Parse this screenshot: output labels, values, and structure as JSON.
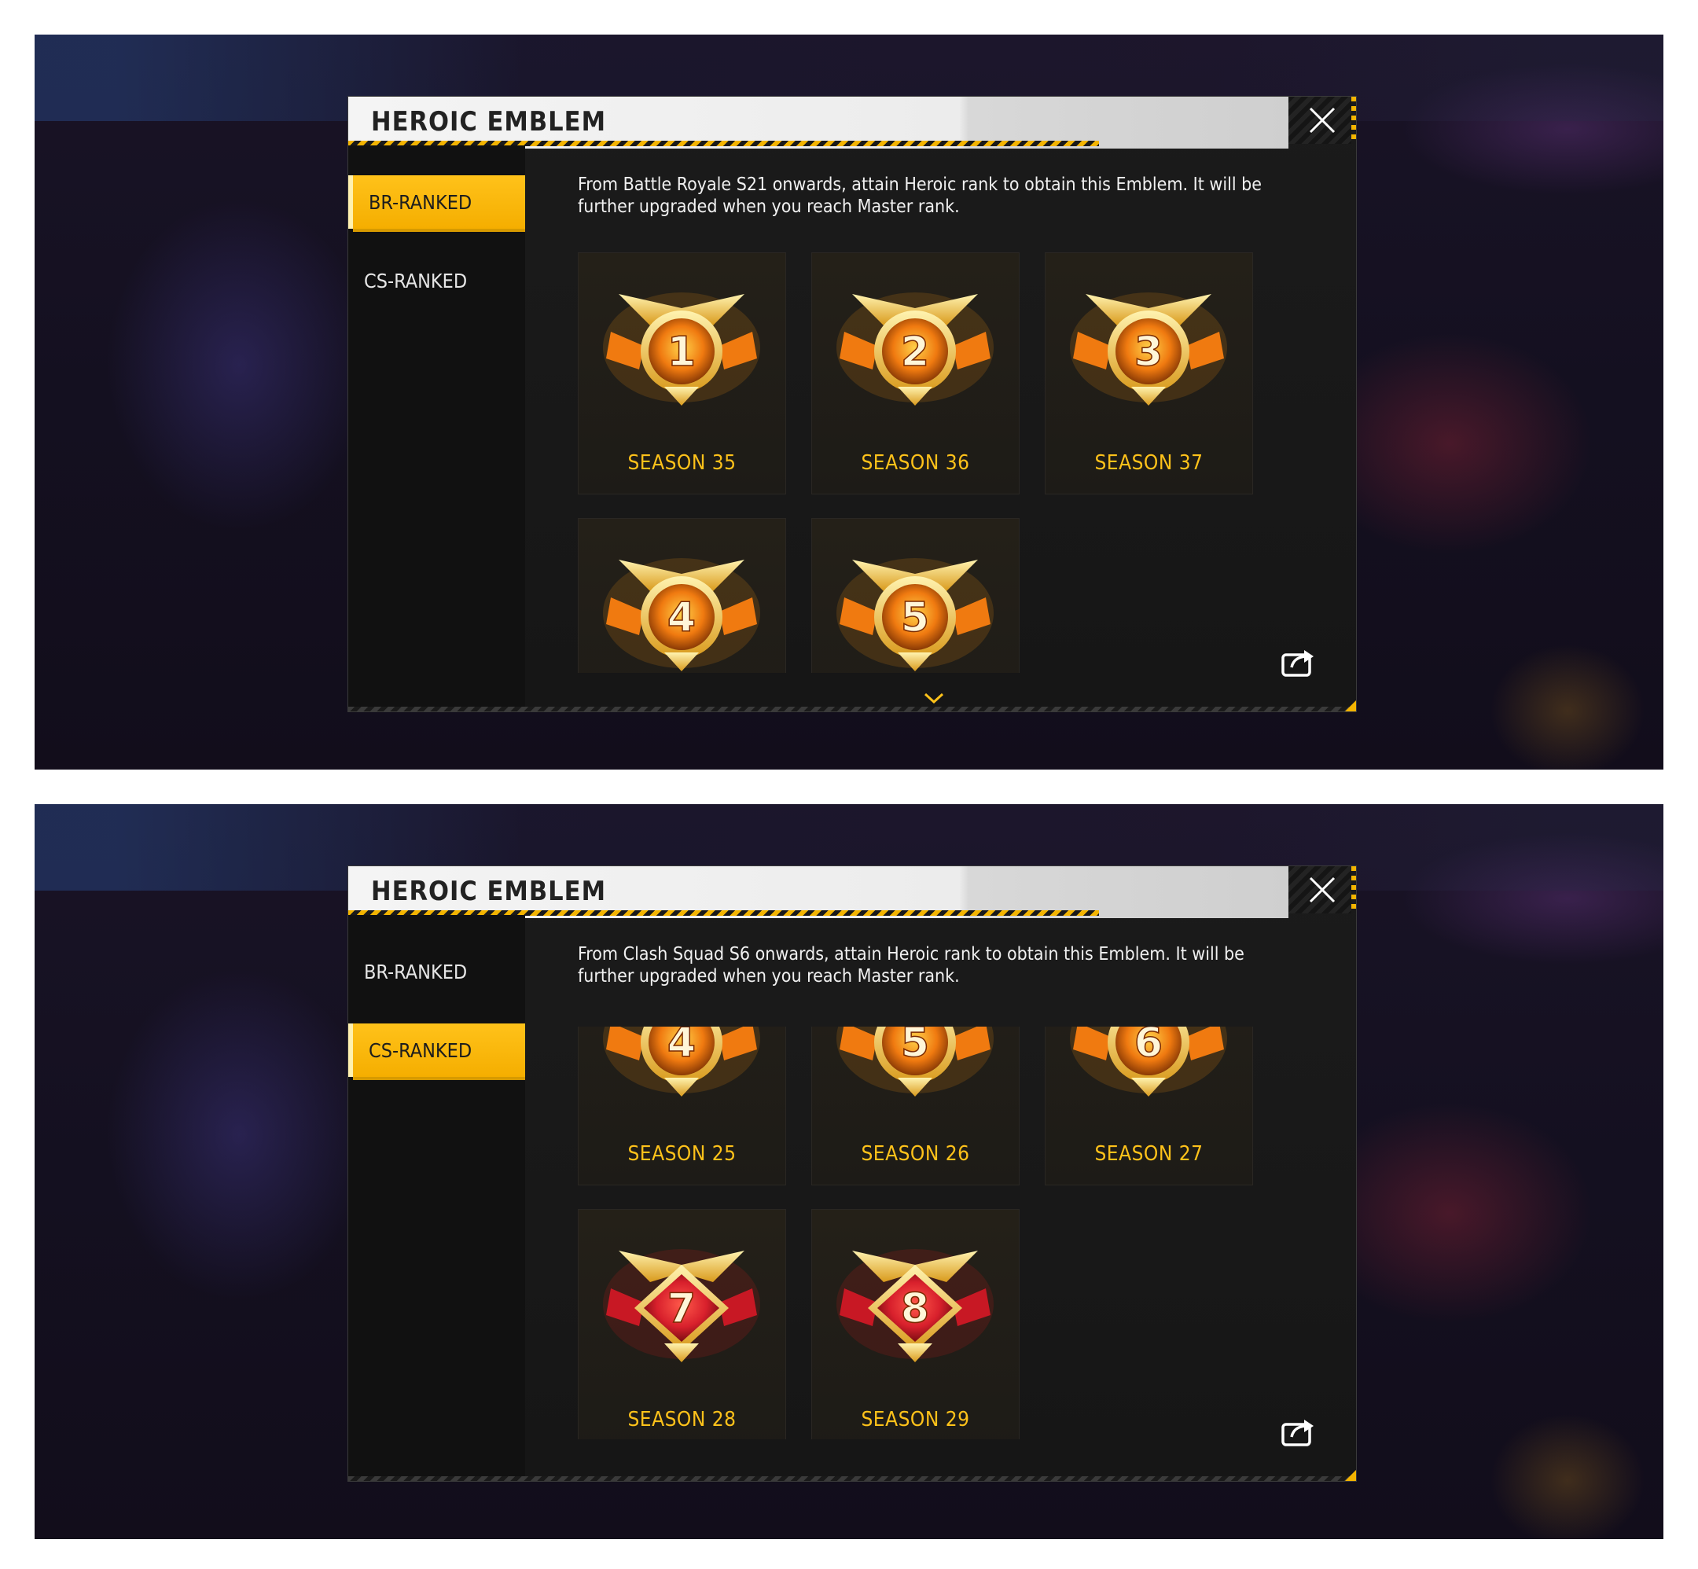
{
  "screens": [
    {
      "title": "HEROIC EMBLEM",
      "tabs": [
        {
          "label": "BR-RANKED",
          "active": true
        },
        {
          "label": "CS-RANKED",
          "active": false
        }
      ],
      "description": "From Battle Royale S21 onwards, attain Heroic rank to obtain this Emblem. It will be further upgraded when you reach Master rank.",
      "emblems": [
        {
          "number": "1",
          "label": "SEASON 35",
          "style": "gold"
        },
        {
          "number": "2",
          "label": "SEASON 36",
          "style": "gold"
        },
        {
          "number": "3",
          "label": "SEASON 37",
          "style": "gold"
        },
        {
          "number": "4",
          "label": "",
          "style": "gold"
        },
        {
          "number": "5",
          "label": "",
          "style": "gold"
        }
      ]
    },
    {
      "title": "HEROIC EMBLEM",
      "tabs": [
        {
          "label": "BR-RANKED",
          "active": false
        },
        {
          "label": "CS-RANKED",
          "active": true
        }
      ],
      "description": "From Clash Squad S6 onwards, attain Heroic rank to obtain this Emblem. It will be further upgraded when you reach Master rank.",
      "emblems": [
        {
          "number": "4",
          "label": "SEASON 25",
          "style": "gold"
        },
        {
          "number": "5",
          "label": "SEASON 26",
          "style": "gold"
        },
        {
          "number": "6",
          "label": "SEASON 27",
          "style": "gold"
        },
        {
          "number": "7",
          "label": "SEASON 28",
          "style": "red"
        },
        {
          "number": "8",
          "label": "SEASON 29",
          "style": "red"
        }
      ]
    }
  ],
  "icons": {
    "close": "close-icon",
    "share": "share-icon",
    "scroll": "chevron-down-icon"
  },
  "colors": {
    "accent": "#ffc21a",
    "panel": "#1b1b1b",
    "header": "#f0f0f0",
    "emblem_red": "#d8202c"
  }
}
